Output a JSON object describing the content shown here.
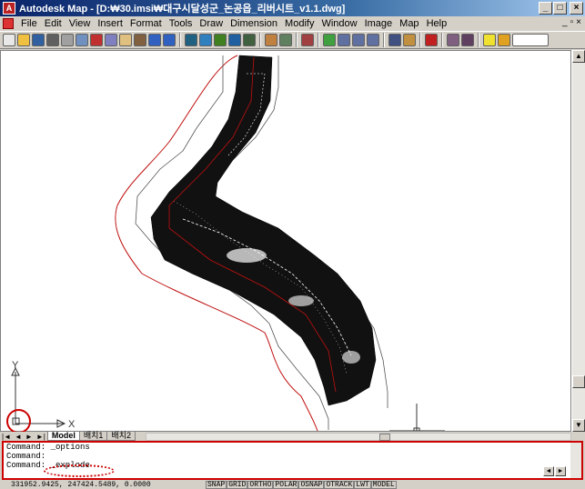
{
  "window": {
    "title": "Autodesk Map - [D:₩30.imsi₩대구시달성군_논공읍_리버시트_v1.1.dwg]",
    "app_icon_glyph": "A",
    "controls": {
      "minimize": "_",
      "maximize": "□",
      "close": "×"
    }
  },
  "menubar": {
    "items": [
      "File",
      "Edit",
      "View",
      "Insert",
      "Format",
      "Tools",
      "Draw",
      "Dimension",
      "Modify",
      "Window",
      "Image",
      "Map",
      "Help"
    ],
    "mdi_controls": {
      "minimize": "_",
      "restore": "▫",
      "close": "×"
    }
  },
  "toolbar": {
    "icons": [
      "new-icon",
      "open-icon",
      "save-icon",
      "print-icon",
      "print-preview-icon",
      "find-icon",
      "cut-icon",
      "copy-icon",
      "paste-icon",
      "match-properties-icon",
      "undo-icon",
      "redo-icon",
      "sep",
      "map-icon",
      "publish-icon",
      "cloud-icon",
      "globe-icon",
      "orbit-icon",
      "sep",
      "ucs-icon",
      "dimension-icon",
      "sep",
      "named-views-icon",
      "sep",
      "pan-icon",
      "zoom-realtime-icon",
      "zoom-window-icon",
      "zoom-previous-icon",
      "sep",
      "properties-icon",
      "design-center-icon",
      "sep",
      "help-icon",
      "sep",
      "layers-icon",
      "layer-state-icon",
      "sep",
      "lightbulb-icon",
      "sun-icon",
      "layer-dropdown"
    ],
    "colors": [
      "#e8e8e8",
      "#f0c040",
      "#3060a0",
      "#606060",
      "#a0a0a0",
      "#7090c0",
      "#c03030",
      "#8080c0",
      "#e0c080",
      "#806040",
      "#3060c0",
      "#3060c0",
      "sep",
      "#206080",
      "#3080c0",
      "#408020",
      "#2060a0",
      "#406040",
      "sep",
      "#c08040",
      "#608060",
      "sep",
      "#a04040",
      "sep",
      "#40a040",
      "#6070a0",
      "#6070a0",
      "#6070a0",
      "sep",
      "#405080",
      "#c09040",
      "sep",
      "#c02020",
      "sep",
      "#806080",
      "#604060",
      "sep",
      "#f0e030",
      "#e0a020",
      "#ffffff"
    ]
  },
  "drawing": {
    "ucs_axis_y": "Y",
    "ucs_axis_x": "X"
  },
  "layout_tabs": {
    "nav": [
      "|◄",
      "◄",
      "►",
      "►|"
    ],
    "tabs": [
      {
        "label": "Model",
        "active": true
      },
      {
        "label": "배치1",
        "active": false
      },
      {
        "label": "배치2",
        "active": false
      }
    ]
  },
  "command": {
    "lines": [
      "Command: _options",
      "Command:",
      "Command: _explode"
    ]
  },
  "status": {
    "coords": "331952.9425, 247424.5489, 0.0000",
    "buttons": [
      "SNAP",
      "GRID",
      "ORTHO",
      "POLAR",
      "OSNAP",
      "OTRACK",
      "LWT",
      "MODEL"
    ]
  }
}
